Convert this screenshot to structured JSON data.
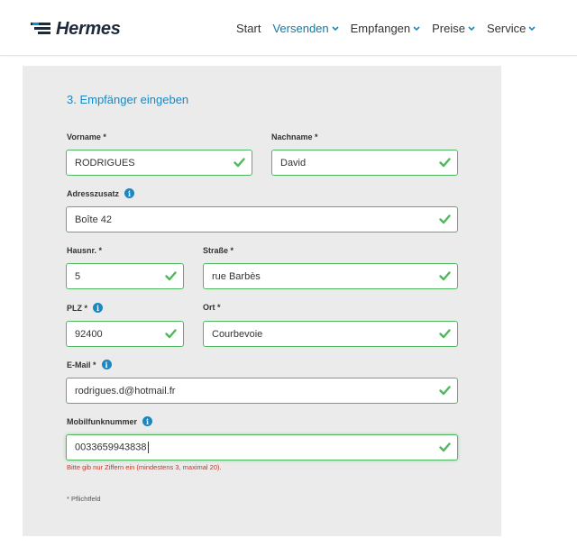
{
  "header": {
    "logo_text": "Hermes",
    "nav": [
      {
        "label": "Start",
        "active": false,
        "dropdown": false
      },
      {
        "label": "Versenden",
        "active": true,
        "dropdown": true
      },
      {
        "label": "Empfangen",
        "active": false,
        "dropdown": true
      },
      {
        "label": "Preise",
        "active": false,
        "dropdown": true
      },
      {
        "label": "Service",
        "active": false,
        "dropdown": true
      }
    ]
  },
  "form": {
    "title": "3. Empfänger eingeben",
    "fields": {
      "vorname": {
        "label": "Vorname *",
        "value": "RODRIGUES"
      },
      "nachname": {
        "label": "Nachname *",
        "value": "David"
      },
      "adresszusatz": {
        "label": "Adresszusatz",
        "value": "Boîte 42"
      },
      "hausnr": {
        "label": "Hausnr. *",
        "value": "5"
      },
      "strasse": {
        "label": "Straße *",
        "value": "rue Barbès"
      },
      "plz": {
        "label": "PLZ *",
        "value": "92400"
      },
      "ort": {
        "label": "Ort *",
        "value": "Courbevoie"
      },
      "email": {
        "label": "E-Mail *",
        "value": "rodrigues.d@hotmail.fr"
      },
      "mobil": {
        "label": "Mobilfunknummer",
        "value": "0033659943838"
      }
    },
    "error_text": "Bitte gib nur Ziffern ein (mindestens 3, maximal 20).",
    "required_note": "* Pflichtfeld",
    "info_icon_glyph": "i"
  },
  "colors": {
    "accent": "#1c87c0",
    "valid": "#4fb85e",
    "error": "#c0392b",
    "panel": "#ebebeb"
  }
}
